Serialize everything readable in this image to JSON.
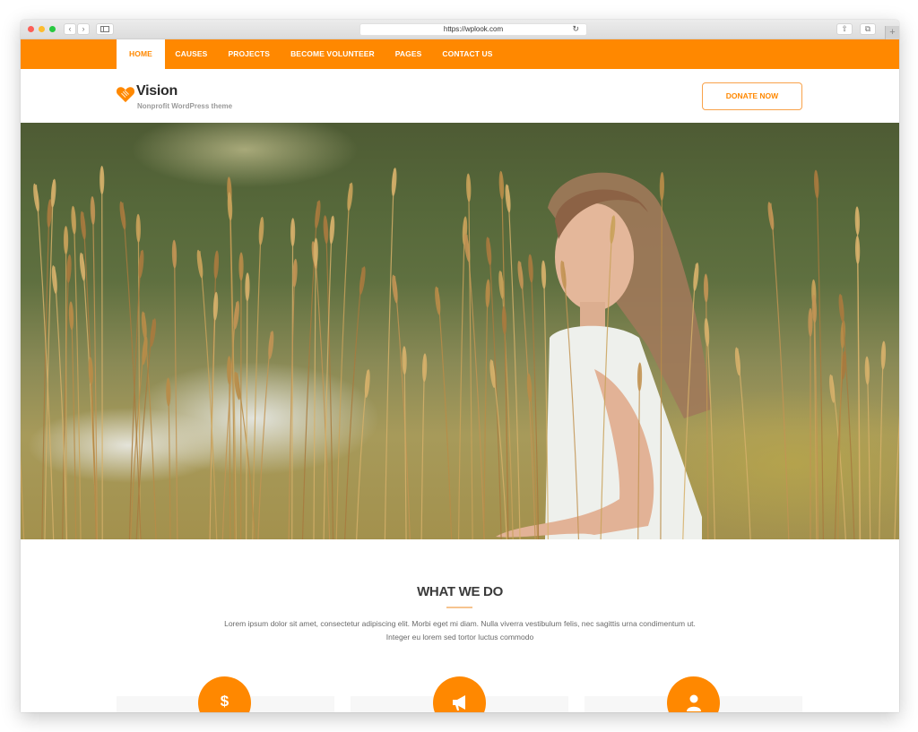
{
  "browser": {
    "url": "https://wplook.com",
    "back_label": "‹",
    "forward_label": "›",
    "reload_label": "↻",
    "new_tab_label": "+",
    "share_label": "⇧",
    "tabs_label": "⧉"
  },
  "nav": {
    "items": [
      {
        "label": "HOME",
        "active": true
      },
      {
        "label": "CAUSES"
      },
      {
        "label": "PROJECTS"
      },
      {
        "label": "BECOME VOLUNTEER"
      },
      {
        "label": "PAGES"
      },
      {
        "label": "CONTACT US"
      }
    ]
  },
  "header": {
    "logo_title": "Vision",
    "logo_tagline": "Nonprofit WordPress theme",
    "logo_icon": "heart-hands-icon",
    "donate_label": "DONATE NOW"
  },
  "hero": {
    "image_description": "girl standing in tall golden grass by a river"
  },
  "what_we_do": {
    "title": "WHAT WE DO",
    "text": "Lorem ipsum dolor sit amet, consectetur adipiscing elit. Morbi eget mi diam. Nulla viverra vestibulum felis, nec sagittis urna condimentum ut. Integer eu lorem sed tortor luctus commodo",
    "features": [
      {
        "icon": "dollar-icon",
        "glyph": "$"
      },
      {
        "icon": "megaphone-icon"
      },
      {
        "icon": "user-icon"
      }
    ]
  },
  "colors": {
    "brand_orange": "#ff8800",
    "text_dark": "#3a3a3a",
    "text_muted": "#6a6a6a"
  }
}
